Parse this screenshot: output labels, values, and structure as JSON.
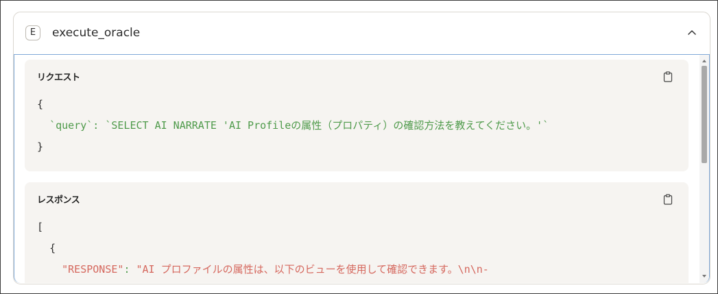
{
  "tool": {
    "badge": "E",
    "name": "execute_oracle",
    "collapse_icon": "chevron-up-icon"
  },
  "request": {
    "title": "リクエスト",
    "copy_icon": "clipboard-icon",
    "lines": {
      "open": "{",
      "key": "`query`",
      "colon": ": ",
      "value": "`SELECT AI NARRATE 'AI Profileの属性（プロパティ）の確認方法を教えてください。'`",
      "close": "}"
    }
  },
  "response": {
    "title": "レスポンス",
    "copy_icon": "clipboard-icon",
    "lines": {
      "open_bracket": "[",
      "open_brace": "{",
      "key": "\"RESPONSE\"",
      "colon": ": ",
      "value": "\"AI プロファイルの属性は、以下のビューを使用して確認できます。\\n\\n-"
    }
  },
  "colors": {
    "key_green": "#4e9a4a",
    "key_red": "#d5675d",
    "panel_bg": "#f6f4f1",
    "focus_border": "#7fa8d8"
  }
}
